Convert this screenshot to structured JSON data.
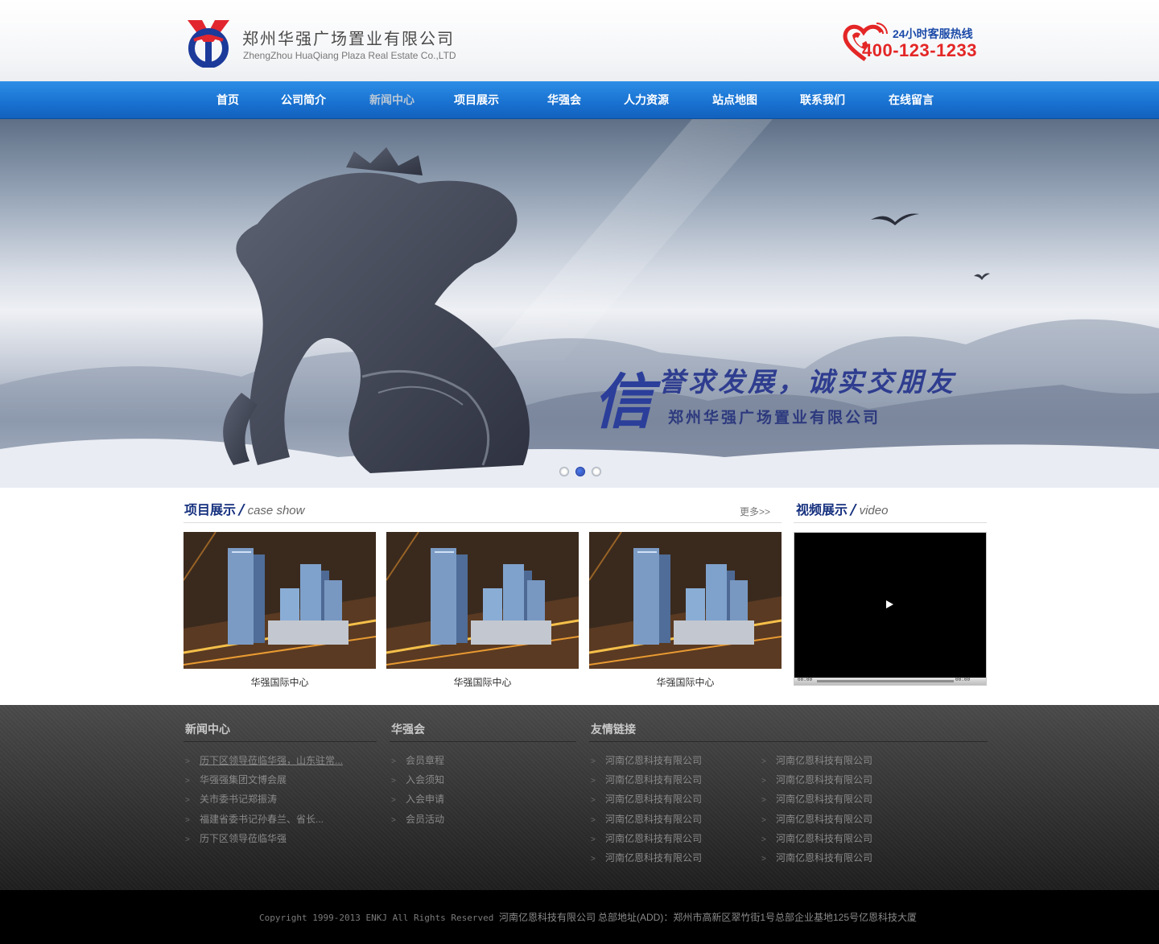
{
  "header": {
    "company_cn": "郑州华强广场置业有限公司",
    "company_en": "ZhengZhou HuaQiang Plaza Real Estate Co.,LTD",
    "hotline_label": "24小时客服热线",
    "hotline_number": "400-123-1233"
  },
  "nav": {
    "items": [
      "首页",
      "公司简介",
      "新闻中心",
      "项目展示",
      "华强会",
      "人力资源",
      "站点地图",
      "联系我们",
      "在线留言"
    ],
    "active_index": 2
  },
  "banner": {
    "slogan_char": "信",
    "slogan_line1": "誉求发展，诚实交朋友",
    "slogan_line2": "郑州华强广场置业有限公司",
    "slide_count": 3,
    "active_slide": 1
  },
  "cases": {
    "title": "项目展示",
    "subtitle": "case show",
    "more": "更多>>",
    "items": [
      {
        "caption": "华强国际中心"
      },
      {
        "caption": "华强国际中心"
      },
      {
        "caption": "华强国际中心"
      }
    ]
  },
  "video": {
    "title": "视频展示",
    "subtitle": "video",
    "time_start": "00:00",
    "time_end": "00:00"
  },
  "footer": {
    "news": {
      "title": "新闻中心",
      "items": [
        "历下区领导莅临华强，山东驻常...",
        "华强强集团文博会展",
        "关市委书记郑振涛",
        "福建省委书记孙春兰、省长...",
        "历下区领导莅临华强"
      ]
    },
    "club": {
      "title": "华强会",
      "items": [
        "会员章程",
        "入会须知",
        "入会申请",
        "会员活动"
      ]
    },
    "links": {
      "title": "友情链接",
      "col1": [
        "河南亿恩科技有限公司",
        "河南亿恩科技有限公司",
        "河南亿恩科技有限公司",
        "河南亿恩科技有限公司",
        "河南亿恩科技有限公司",
        "河南亿恩科技有限公司"
      ],
      "col2": [
        "河南亿恩科技有限公司",
        "河南亿恩科技有限公司",
        "河南亿恩科技有限公司",
        "河南亿恩科技有限公司",
        "河南亿恩科技有限公司",
        "河南亿恩科技有限公司"
      ]
    }
  },
  "copyright": {
    "text": "Copyright 1999-2013 ENKJ All Rights Reserved",
    "company": "河南亿恩科技有限公司",
    "address": "总部地址(ADD)：郑州市高新区翠竹街1号总部企业基地125号亿恩科技大厦"
  },
  "colors": {
    "nav_blue": "#1a73d2",
    "title_blue": "#15307e",
    "hotline_red": "#e42626",
    "footer_bg": "#363636"
  }
}
